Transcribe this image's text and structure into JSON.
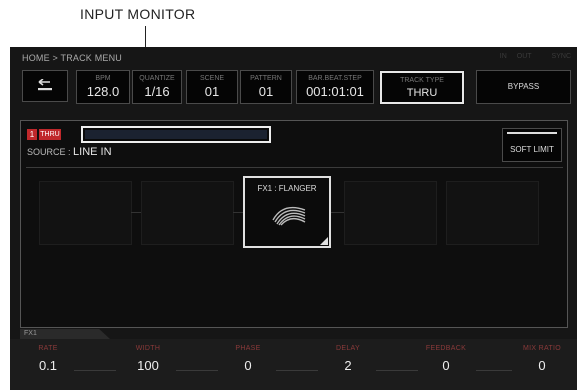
{
  "callout": {
    "label": "INPUT MONITOR"
  },
  "header": {
    "breadcrumb": "HOME > TRACK MENU",
    "status": [
      "IN",
      "OUT",
      "",
      "SYNC"
    ]
  },
  "toolbar": {
    "back_icon": "back-arrow-icon",
    "bpm": {
      "label": "BPM",
      "value": "128.0"
    },
    "quantize": {
      "label": "QUANTIZE",
      "value": "1/16"
    },
    "scene": {
      "label": "SCENE",
      "value": "01"
    },
    "pattern": {
      "label": "PATTERN",
      "value": "01"
    },
    "bar_beat_step": {
      "label": "BAR.BEAT.STEP",
      "value": "001:01:01"
    },
    "track_type": {
      "label": "TRACK TYPE",
      "value": "THRU"
    },
    "bypass_label": "BYPASS"
  },
  "track": {
    "number": "1",
    "type_badge": "THRU",
    "source_label": "SOURCE :",
    "source_value": "LINE IN",
    "soft_limit_label": "SOFT LIMIT"
  },
  "fx": {
    "tab_label": "FX1",
    "slot_title": "FX1 : FLANGER",
    "icon": "flanger-wave-icon"
  },
  "params": [
    {
      "label": "RATE",
      "value": "0.1"
    },
    {
      "label": "WIDTH",
      "value": "100"
    },
    {
      "label": "PHASE",
      "value": "0"
    },
    {
      "label": "DELAY",
      "value": "2"
    },
    {
      "label": "FEEDBACK",
      "value": "0"
    },
    {
      "label": "MIX RATIO",
      "value": "0"
    }
  ],
  "colors": {
    "accent_red": "#c0282b",
    "highlight": "#e8e8e8",
    "screen_bg": "#161616"
  }
}
